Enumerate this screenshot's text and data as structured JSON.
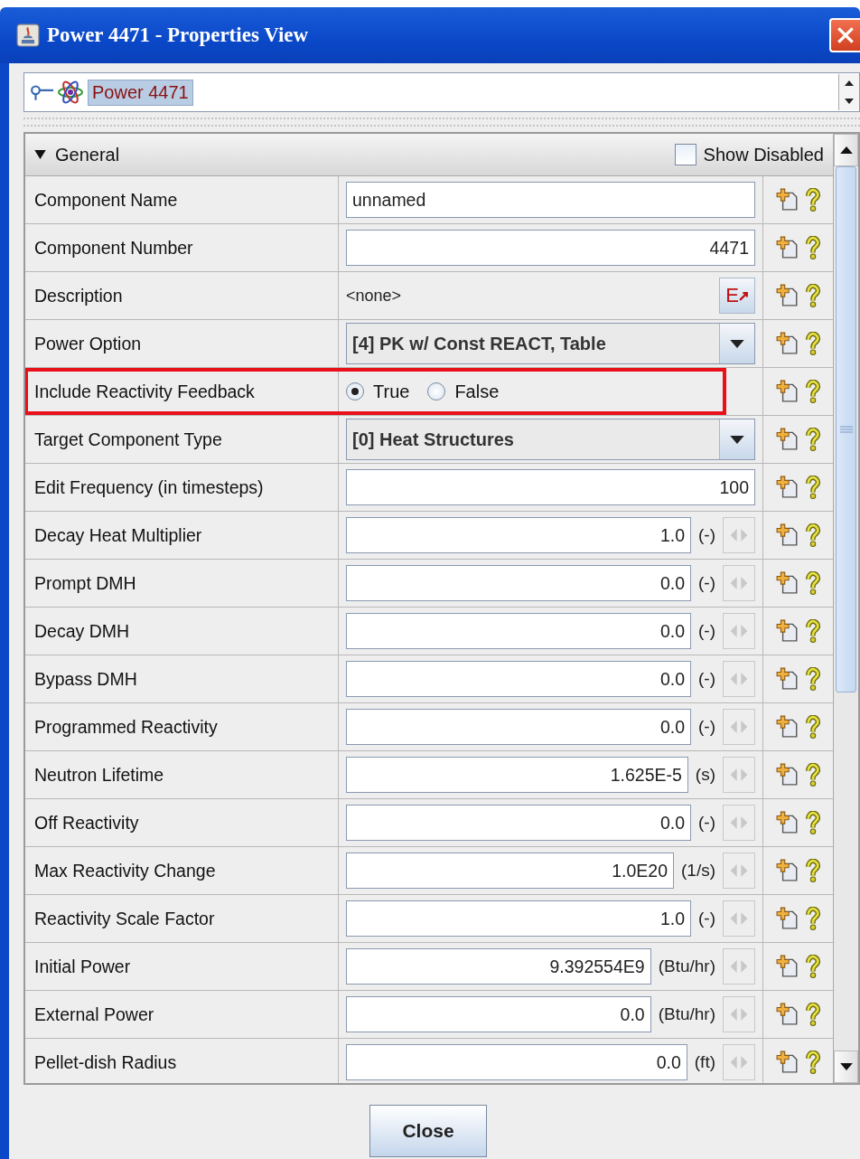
{
  "window": {
    "title": "Power 4471 - Properties View"
  },
  "tree": {
    "label": "Power 4471",
    "selected": true
  },
  "panel": {
    "section": "General",
    "expanded": true,
    "show_disabled": {
      "label": "Show Disabled",
      "checked": false
    }
  },
  "rows": [
    {
      "kind": "text",
      "label": "Component Name",
      "value": "unnamed",
      "highlighted": false
    },
    {
      "kind": "number",
      "label": "Component Number",
      "value": "4471",
      "highlighted": false
    },
    {
      "kind": "description",
      "label": "Description",
      "value": "<none>",
      "edit_button": "E",
      "highlighted": false
    },
    {
      "kind": "combo",
      "label": "Power Option",
      "value": "[4] PK w/ Const REACT, Table",
      "highlighted": false
    },
    {
      "kind": "radio",
      "label": "Include Reactivity Feedback",
      "options": [
        {
          "label": "True",
          "selected": true
        },
        {
          "label": "False",
          "selected": false
        }
      ],
      "highlighted": true
    },
    {
      "kind": "combo",
      "label": "Target Component Type",
      "value": "[0] Heat Structures",
      "highlighted": false
    },
    {
      "kind": "number",
      "label": "Edit Frequency (in timesteps)",
      "value": "100",
      "highlighted": false
    },
    {
      "kind": "unit",
      "label": "Decay Heat Multiplier",
      "value": "1.0",
      "unit": "(-)",
      "highlighted": false
    },
    {
      "kind": "unit",
      "label": "Prompt DMH",
      "value": "0.0",
      "unit": "(-)",
      "highlighted": false
    },
    {
      "kind": "unit",
      "label": "Decay DMH",
      "value": "0.0",
      "unit": "(-)",
      "highlighted": false
    },
    {
      "kind": "unit",
      "label": "Bypass DMH",
      "value": "0.0",
      "unit": "(-)",
      "highlighted": false
    },
    {
      "kind": "unit",
      "label": "Programmed Reactivity",
      "value": "0.0",
      "unit": "(-)",
      "highlighted": false
    },
    {
      "kind": "unit",
      "label": "Neutron Lifetime",
      "value": "1.625E-5",
      "unit": "(s)",
      "highlighted": false
    },
    {
      "kind": "unit",
      "label": "Off Reactivity",
      "value": "0.0",
      "unit": "(-)",
      "highlighted": false
    },
    {
      "kind": "unit",
      "label": "Max Reactivity Change",
      "value": "1.0E20",
      "unit": "(1/s)",
      "highlighted": false
    },
    {
      "kind": "unit",
      "label": "Reactivity Scale Factor",
      "value": "1.0",
      "unit": "(-)",
      "highlighted": false
    },
    {
      "kind": "unit",
      "label": "Initial Power",
      "value": "9.392554E9",
      "unit": "(Btu/hr)",
      "highlighted": false
    },
    {
      "kind": "unit",
      "label": "External Power",
      "value": "0.0",
      "unit": "(Btu/hr)",
      "highlighted": false
    },
    {
      "kind": "unit",
      "label": "Pellet-dish Radius",
      "value": "0.0",
      "unit": "(ft)",
      "highlighted": false
    }
  ],
  "buttons": [
    "Close"
  ]
}
